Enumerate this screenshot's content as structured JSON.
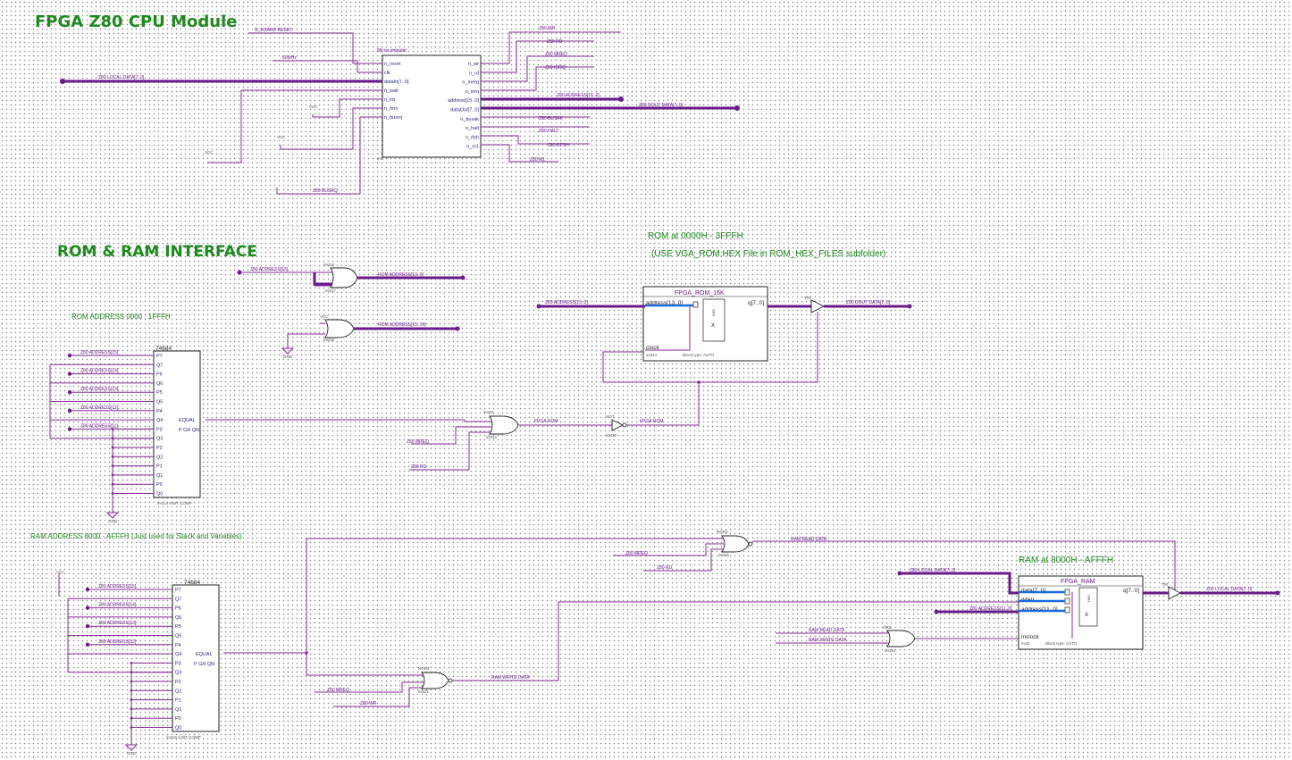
{
  "titles": {
    "cpu": "FPGA Z80 CPU Module",
    "rom_ram": "ROM & RAM INTERFACE"
  },
  "notes": {
    "rom_addr": "ROM ADDRESS 0000 : 1FFFH",
    "ram_addr": "RAM ADDRESS 8000 - AFFFH (Just used for Stack and Variables)",
    "rom_at": "ROM at 0000H - 3FFFH",
    "rom_use": "(USE VGA_ROM.HEX File in ROM_HEX_FILES subfolder)",
    "ram_at": "RAM at 8000H - AFFFH"
  },
  "cpu": {
    "name": "Microcomputer",
    "inst": "inst",
    "left_pins": [
      "n_reset",
      "clk",
      "dataIn[7..0]",
      "n_wait",
      "n_int",
      "n_nmi",
      "n_busrq"
    ],
    "right_pins": [
      "n_wr",
      "n_rd",
      "n_mreq",
      "n_iorq",
      "address[15..0]",
      "dataOut[7..0]",
      "n_busak",
      "n_halt",
      "n_rfsh",
      "n_m1"
    ],
    "in_labels": [
      "Z80 LOCAL DATA[7..0]",
      "N_BOARD RESET",
      "50MHz",
      "VCC",
      "VCC",
      "VCC",
      "Z80 BUSRQ"
    ],
    "out_labels": [
      "Z80 WR",
      "Z80 RD",
      "Z80 MREQ",
      "Z80 IORQ",
      "Z80 ADDRESS[15..0]",
      "Z80 DOUT DATA[7..0]",
      "Z80 BUSAK",
      "Z80 HALT",
      "Z80 RFSH",
      "Z80 M1"
    ]
  },
  "rom_comp": {
    "name": "74684",
    "inst": "inst14  8 BIT COMP",
    "pins": [
      "P7",
      "Q7",
      "P6",
      "Q6",
      "P5",
      "Q5",
      "P4",
      "Q4",
      "P3",
      "Q3",
      "P2",
      "Q2",
      "P1",
      "Q1",
      "P0",
      "Q0"
    ],
    "outs": [
      "EQUAL",
      "P GR QN"
    ],
    "addr_labels": [
      "Z80 ADDRESS[15]",
      "Z80 ADDRESS[14]",
      "Z80 ADDRESS[13]",
      "Z80 ADDRESS[12]",
      "Z80 ADDRESS[11]"
    ]
  },
  "ram_comp": {
    "name": "74684",
    "inst": "inst16  8 BIT COMP",
    "pins": [
      "P7",
      "Q7",
      "P6",
      "Q6",
      "P5",
      "Q5",
      "P4",
      "Q4",
      "P3",
      "Q3",
      "P2",
      "Q2",
      "P1",
      "Q1",
      "P0",
      "Q0"
    ],
    "outs": [
      "EQUAL",
      "P GR QN"
    ],
    "addr_labels": [
      "Z80 ADDRESS[15]",
      "Z80 ADDRESS[14]",
      "Z80 ADDRESS[13]",
      "Z80 ADDRESS[12]"
    ]
  },
  "rom": {
    "name": "FPGA_ROM_16K",
    "pins": [
      "address[13..0]",
      "clock",
      "q[7..0]"
    ],
    "inst": "inst44",
    "block": "Block type: AUTO",
    "in_label": "Z80 ADDRESS[13..0]",
    "out_label": "Z80 DOUT DATA[7..0]"
  },
  "ram": {
    "name": "FPGA_RAM",
    "pins": [
      "data[7..0]",
      "wren",
      "address[11..0]",
      "inclock",
      "q[7..0]"
    ],
    "inst": "inst2",
    "block": "Block type: AUTO",
    "in_labels": [
      "Z80 LOCAL DATA[7..0]",
      "Z80 ADDRESS[11..0]"
    ],
    "out_label": "Z80 LOCAL DATA[7..0]"
  },
  "gate_labels": {
    "g_top1": "inst17",
    "g_top2": "inst18",
    "rom_addr_out1": "ROM ADDRESS[13..0]",
    "rom_addr_out2": "ROM ADDRESS[15..14]",
    "fpga_rom": "FPGA ROM",
    "rom_or_in": [
      "Z80 MREQ",
      "Z80 RD"
    ],
    "ram_read": "RAM READ DATA",
    "ram_write": "RAM WRITE DATA",
    "ram_nor_in": [
      "Z80 MREQ",
      "Z80 RD"
    ],
    "ram_wr_in": [
      "Z80 MREQ",
      "Z80 WR"
    ],
    "vcc": "VCC",
    "gnd": "GND"
  }
}
